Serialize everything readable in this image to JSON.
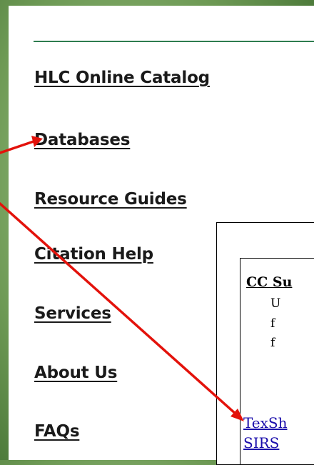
{
  "nav": {
    "items": [
      {
        "label": "HLC Online Catalog"
      },
      {
        "label": "Databases"
      },
      {
        "label": "Resource Guides"
      },
      {
        "label": "Citation Help"
      },
      {
        "label": "Services"
      },
      {
        "label": "About Us"
      },
      {
        "label": "FAQs"
      }
    ]
  },
  "content": {
    "heading": "CC Su",
    "desc_lines": [
      "U",
      "f",
      "f"
    ],
    "links": [
      "TexSh",
      "SIRS"
    ]
  },
  "colors": {
    "annotation_arrow": "#e3120b",
    "link": "#1a0dab",
    "accent_rule": "#2e7d4f"
  }
}
